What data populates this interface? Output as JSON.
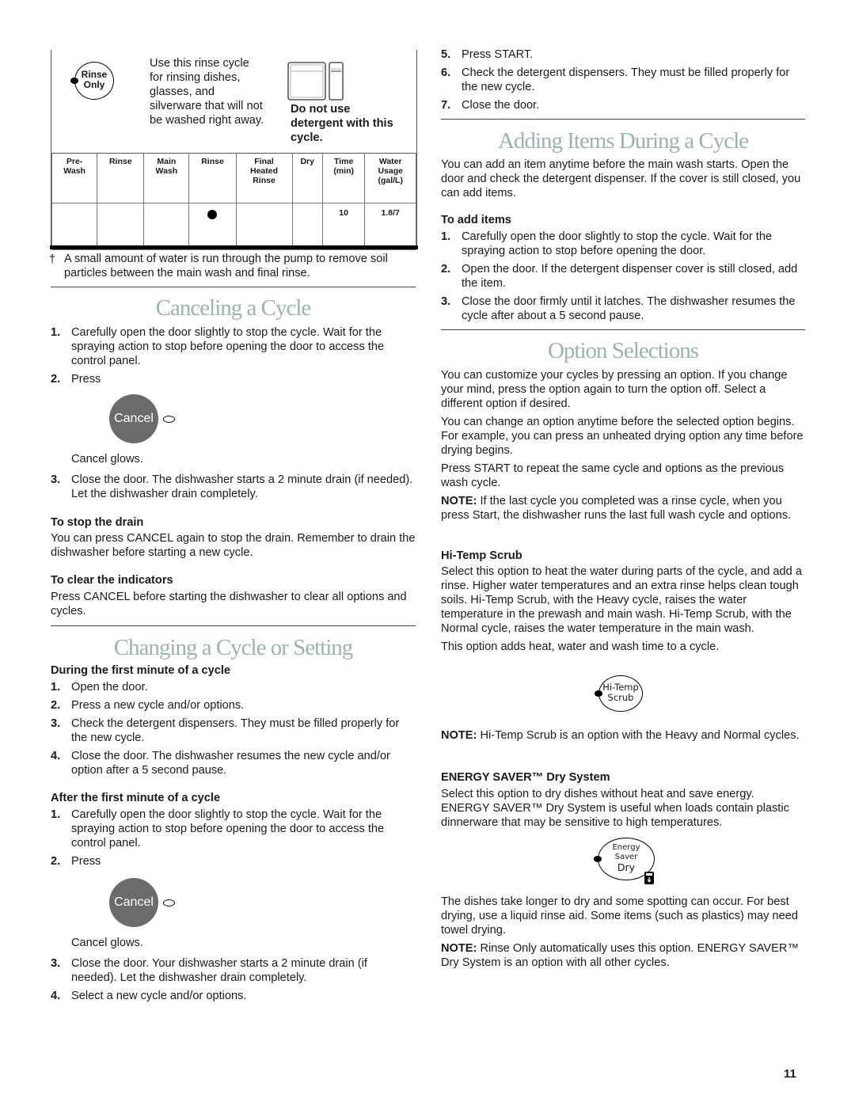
{
  "rinse_only": {
    "button_label_line1": "Rinse",
    "button_label_line2": "Only",
    "description": [
      "Use this rinse cycle",
      "for rinsing dishes,",
      "glasses, and",
      "silverware that will not",
      "be washed right away."
    ],
    "warning": [
      "Do not use",
      "detergent with this",
      "cycle."
    ],
    "table": {
      "headers": [
        [
          "Pre-",
          "Wash"
        ],
        [
          "Rinse"
        ],
        [
          "Main",
          "Wash"
        ],
        [
          "Rinse"
        ],
        [
          "Final",
          "Heated",
          "Rinse"
        ],
        [
          "Dry"
        ],
        [
          "Time",
          "(min)"
        ],
        [
          "Water",
          "Usage",
          "(gal/L)"
        ]
      ],
      "row": [
        "",
        "",
        "",
        "dot",
        "",
        "",
        "10",
        "1.8/7"
      ]
    },
    "footnote_mark": "†",
    "footnote": "A small amount of water is run through the pump to remove soil particles between the main wash and final rinse."
  },
  "canceling": {
    "title": "Canceling a Cycle",
    "steps": [
      {
        "num": "1.",
        "text": "Carefully open the door slightly to stop the cycle. Wait for the spraying action to stop before opening the door to access the control panel."
      },
      {
        "num": "2.",
        "text": "Press"
      },
      {
        "num": "3.",
        "text": "Close the door. The dishwasher starts a 2 minute drain (if needed). Let the dishwasher drain completely."
      }
    ],
    "cancel_button": "Cancel",
    "cancel_glows": "Cancel glows.",
    "stop_drain_heading": "To stop the drain",
    "stop_drain_text": "You can press CANCEL again to stop the drain. Remember to drain the dishwasher before starting a new cycle.",
    "clear_heading": "To clear the indicators",
    "clear_text": "Press CANCEL before starting the dishwasher to clear all options and cycles."
  },
  "changing": {
    "title": "Changing a Cycle or Setting",
    "during_heading": "During the first minute of a cycle",
    "during_steps": [
      {
        "num": "1.",
        "text": "Open the door."
      },
      {
        "num": "2.",
        "text": "Press a new cycle and/or options."
      },
      {
        "num": "3.",
        "text": "Check the detergent dispensers. They must be filled properly for the new cycle."
      },
      {
        "num": "4.",
        "text": "Close the door. The dishwasher resumes the new cycle and/or option after a 5 second pause."
      }
    ],
    "after_heading": "After the first minute of a cycle",
    "after_steps": [
      {
        "num": "1.",
        "text": "Carefully open the door slightly to stop the cycle. Wait for the spraying action to stop before opening the door to access the control panel."
      },
      {
        "num": "2.",
        "text": "Press"
      },
      {
        "num": "3.",
        "text": "Close the door. Your dishwasher starts a 2 minute drain (if needed). Let the dishwasher drain completely."
      },
      {
        "num": "4.",
        "text": "Select a new cycle and/or options."
      }
    ],
    "cancel_button": "Cancel",
    "cancel_glows": "Cancel glows.",
    "cont_steps": [
      {
        "num": "5.",
        "text": "Press START."
      },
      {
        "num": "6.",
        "text": "Check the detergent dispensers. They must be filled properly for the new cycle."
      },
      {
        "num": "7.",
        "text": "Close the door."
      }
    ]
  },
  "adding": {
    "title": "Adding Items During a Cycle",
    "intro": "You can add an item anytime before the main wash starts. Open the door and check the detergent dispenser. If the cover is still closed, you can add items.",
    "heading": "To add items",
    "steps": [
      {
        "num": "1.",
        "text": "Carefully open the door slightly to stop the cycle. Wait for the spraying action to stop before opening the door."
      },
      {
        "num": "2.",
        "text": "Open the door. If the detergent dispenser cover is still closed, add the item."
      },
      {
        "num": "3.",
        "text": "Close the door firmly until it latches. The dishwasher resumes the cycle after about a 5 second pause."
      }
    ]
  },
  "options": {
    "title": "Option Selections",
    "p1": "You can customize your cycles by pressing an option. If you change your mind, press the option again to turn the option off. Select a different option if desired.",
    "p2": "You can change an option anytime before the selected option begins. For example, you can press an unheated drying option any time before drying begins.",
    "p3": "Press START to repeat the same cycle and options as the previous wash cycle.",
    "note_label": "NOTE:",
    "note1": " If the last cycle you completed was a rinse cycle, when you press Start, the dishwasher runs the last full wash cycle and options.",
    "hitemp_heading": "Hi-Temp Scrub",
    "hitemp_p1": "Select this option to heat the water during parts of the cycle, and add a rinse. Higher water temperatures and an extra rinse helps clean tough soils. Hi-Temp Scrub, with the Heavy cycle, raises the water temperature in the prewash and main wash. Hi-Temp Scrub, with the Normal cycle, raises the water temperature in the main wash.",
    "hitemp_p2": "This option adds heat, water and wash time to a cycle.",
    "hitemp_btn1": "Hi-Temp",
    "hitemp_btn2": "Scrub",
    "hitemp_note": " Hi-Temp Scrub is an option with the Heavy and Normal cycles.",
    "energy_heading": "ENERGY SAVER™ Dry System",
    "energy_p1": "Select this option to dry dishes without heat and save energy. ENERGY SAVER™ Dry System is useful when loads contain plastic dinnerware that may be sensitive to high temperatures.",
    "energy_btn1": "Energy",
    "energy_btn2": "Saver",
    "energy_btn3": "Dry",
    "energy_p2": "The dishes take longer to dry and some spotting can occur. For best drying, use a liquid rinse aid. Some items (such as plastics) may need towel drying.",
    "energy_note": " Rinse Only automatically uses this option. ENERGY SAVER™ Dry System is an option with all other cycles."
  },
  "page_number": "11"
}
